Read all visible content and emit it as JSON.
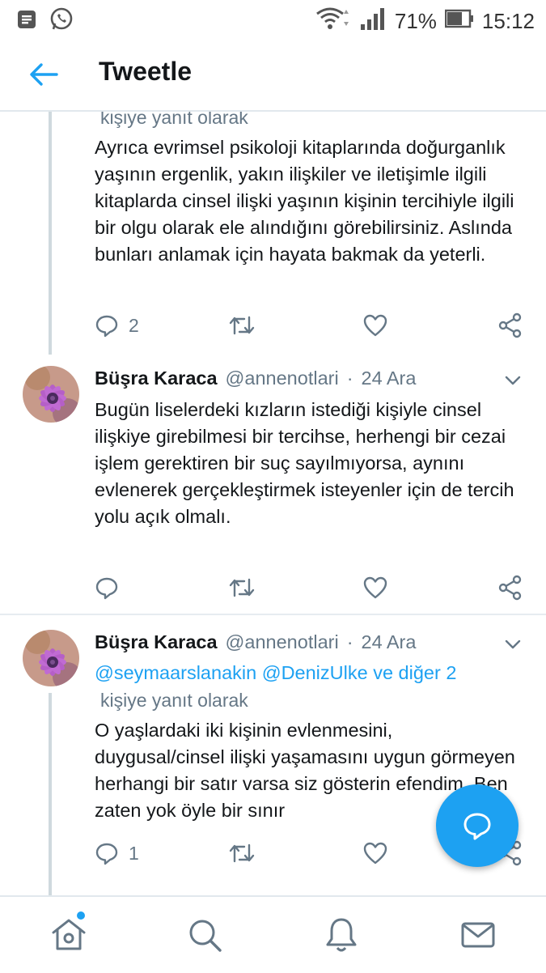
{
  "status_bar": {
    "left_icons": [
      "notes-icon",
      "whatsapp-icon"
    ],
    "battery_percent": "71%",
    "time": "15:12"
  },
  "header": {
    "title": "Tweetle",
    "back_icon": "back-arrow-icon"
  },
  "tweets": [
    {
      "reply_label": "kişiye yanıt olarak",
      "text": "Ayrıca evrimsel psikoloji kitaplarında doğurganlık yaşının ergenlik, yakın ilişkiler ve iletişimle ilgili kitaplarda cinsel ilişki yaşının kişinin tercihiyle ilgili bir olgu olarak ele alındığını görebilirsiniz. Aslında bunları anlamak için hayata bakmak da yeterli.",
      "replies": "2",
      "retweets": "",
      "likes": ""
    },
    {
      "name": "Büşra Karaca",
      "handle": "@annenotlari",
      "separator": "·",
      "date": "24 Ara",
      "text": "Bugün liselerdeki kızların istediği kişiyle cinsel ilişkiye girebilmesi bir tercihse, herhengi bir cezai işlem gerektiren bir suç sayılmıyorsa, aynını evlenerek gerçekleştirmek isteyenler için de tercih yolu açık olmalı.",
      "replies": "",
      "retweets": "",
      "likes": ""
    },
    {
      "name": "Büşra Karaca",
      "handle": "@annenotlari",
      "separator": "·",
      "date": "24 Ara",
      "mention_1": "@seymaarslanakin",
      "mention_2": "@DenizUlke",
      "mention_rest": "ve diğer 2",
      "reply_label": "kişiye yanıt olarak",
      "text": "O yaşlardaki iki kişinin evlenmesini, duygusal/cinsel ilişki yaşamasını uygun görmeyen herhangi bir satır varsa siz gösterin efendim. Ben zaten yok öyle bir sınır",
      "replies": "1",
      "retweets": "",
      "likes": ""
    }
  ],
  "bottom_nav": [
    "home-icon",
    "search-icon",
    "notifications-icon",
    "messages-icon"
  ],
  "colors": {
    "accent": "#1da1f2",
    "muted": "#657786",
    "text": "#14171a",
    "border": "#e1e8ed"
  }
}
